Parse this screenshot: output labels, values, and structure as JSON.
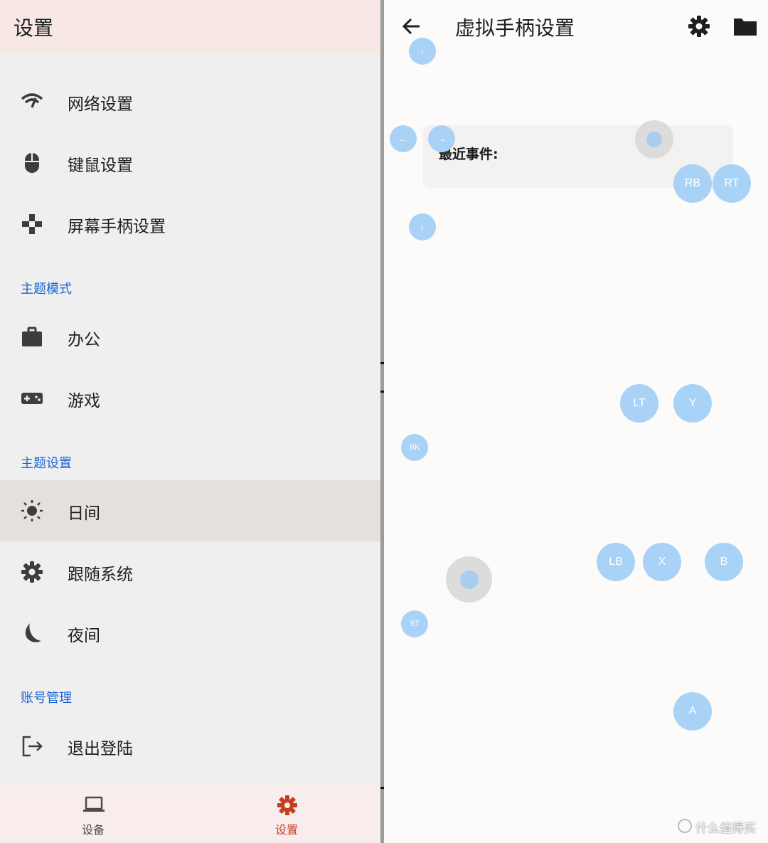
{
  "left": {
    "title": "设置",
    "items_group1": [
      {
        "label": "网络设置",
        "icon": "wifi-icon"
      },
      {
        "label": "键鼠设置",
        "icon": "mouse-icon"
      },
      {
        "label": "屏幕手柄设置",
        "icon": "gamepad-icon"
      }
    ],
    "section_theme_mode": "主题模式",
    "theme_modes": [
      {
        "label": "办公",
        "icon": "briefcase-icon"
      },
      {
        "label": "游戏",
        "icon": "controller-icon"
      }
    ],
    "section_theme_settings": "主题设置",
    "theme_settings": [
      {
        "label": "日间",
        "icon": "sun-icon",
        "selected": true
      },
      {
        "label": "跟随系统",
        "icon": "gear-icon"
      },
      {
        "label": "夜间",
        "icon": "moon-icon"
      }
    ],
    "section_account": "账号管理",
    "account_items": [
      {
        "label": "退出登陆",
        "icon": "logout-icon"
      }
    ],
    "bottom_nav": [
      {
        "label": "设备",
        "icon": "laptop-icon",
        "active": false
      },
      {
        "label": "设置",
        "icon": "gear-icon",
        "active": true
      }
    ]
  },
  "right": {
    "title": "虚拟手柄设置",
    "events_title": "最近事件:",
    "buttons": {
      "up": "↑",
      "left": "←",
      "right": "→",
      "down": "↓",
      "rb": "RB",
      "rt": "RT",
      "lt": "LT",
      "y": "Y",
      "bk": "BK",
      "lb": "LB",
      "x": "X",
      "b": "B",
      "st": "ST",
      "a": "A"
    }
  },
  "watermark": "什么值得买",
  "colors": {
    "accent": "#1a66d6",
    "active_nav": "#c4401f",
    "pad_button": "#a9d2f7",
    "header_bg": "#f7e8e5"
  }
}
